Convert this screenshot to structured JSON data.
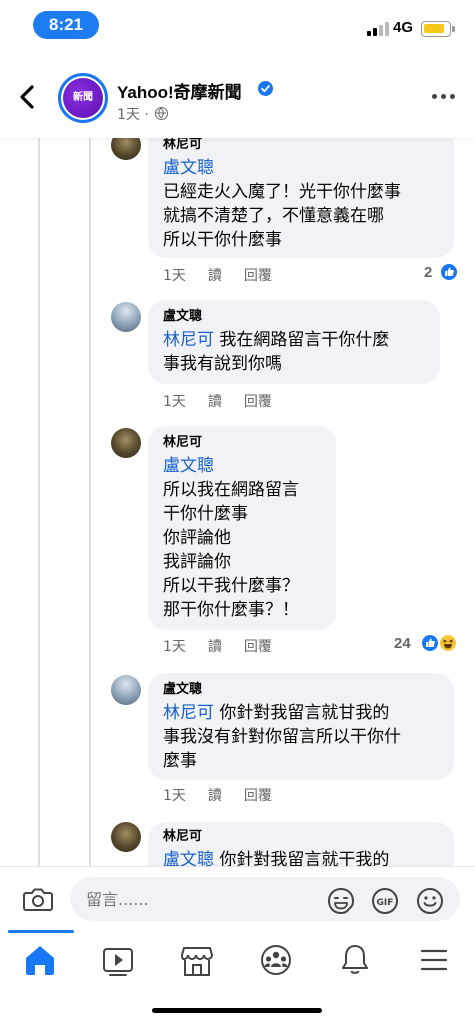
{
  "status_bar": {
    "time": "8:21",
    "network": "4G"
  },
  "header": {
    "page_name": "Yahoo!奇摩新聞",
    "avatar_text": "新聞",
    "post_age": "1天 ·",
    "icons": [
      "back-icon",
      "verified-icon",
      "globe-icon",
      "more-icon"
    ]
  },
  "comments": [
    {
      "author": "林尼可",
      "mention": "盧文聰",
      "text": "已經走火入魔了！光干你什麼事\n就搞不清楚了，不懂意義在哪\n所以干你什麼事",
      "age": "1天",
      "read": "讀",
      "reply": "回覆",
      "reactions": {
        "count": "2",
        "types": [
          "like"
        ]
      }
    },
    {
      "author": "盧文聰",
      "mention": "林尼可",
      "text": " 我在網路留言干你什麼\n事我有說到你嗎",
      "age": "1天",
      "read": "讀",
      "reply": "回覆"
    },
    {
      "author": "林尼可",
      "mention": "盧文聰",
      "text": "所以我在網路留言\n干你什麼事\n你評論他\n我評論你\n所以干我什麼事？\n那干你什麼事？！",
      "age": "1天",
      "read": "讀",
      "reply": "回覆",
      "reactions": {
        "count": "24",
        "types": [
          "like",
          "haha"
        ]
      }
    },
    {
      "author": "盧文聰",
      "mention": "林尼可",
      "text": " 你針對我留言就甘我的\n事我沒有針對你留言所以干你什\n麼事",
      "age": "1天",
      "read": "讀",
      "reply": "回覆"
    },
    {
      "author": "林尼可",
      "mention": "盧文聰",
      "text": " 你針對我留言就干我的"
    }
  ],
  "composer": {
    "placeholder": "留言......"
  },
  "tabs": [
    {
      "name": "home",
      "active": true
    },
    {
      "name": "watch",
      "active": false
    },
    {
      "name": "marketplace",
      "active": false
    },
    {
      "name": "groups",
      "active": false
    },
    {
      "name": "notifications",
      "active": false
    },
    {
      "name": "menu",
      "active": false
    }
  ],
  "colors": {
    "accent": "#1877f2",
    "mention": "#1a62c9",
    "bubble": "#f0f2f5",
    "time_pill": "#1e7cf2"
  }
}
